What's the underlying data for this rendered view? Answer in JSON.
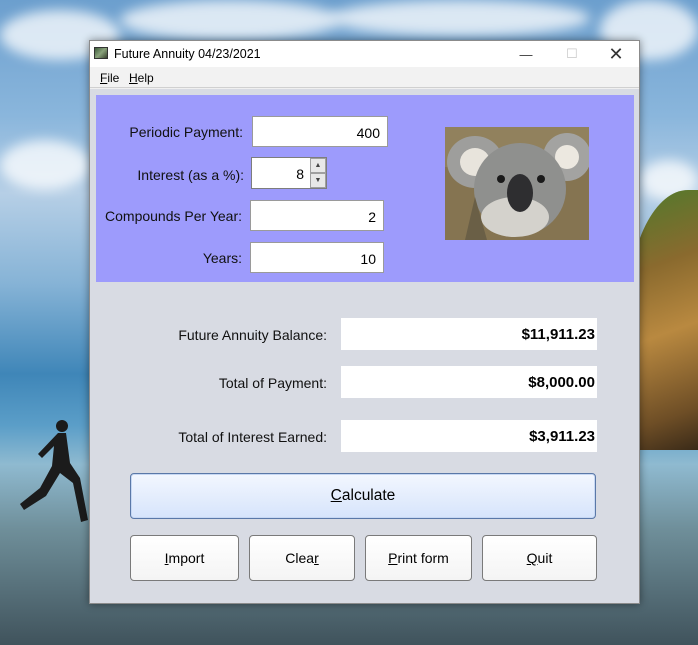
{
  "window": {
    "title": "Future Annuity 04/23/2021",
    "controls": {
      "minimize": "—",
      "maximize": "☐",
      "close": "✕"
    }
  },
  "menu": [
    {
      "mnemonic": "F",
      "rest": "ile"
    },
    {
      "mnemonic": "H",
      "rest": "elp"
    }
  ],
  "inputs": {
    "periodic_payment": {
      "label": "Periodic Payment:",
      "value": "400"
    },
    "interest": {
      "label": "Interest (as a %):",
      "value": "8"
    },
    "compounds": {
      "label": "Compounds Per Year:",
      "value": "2"
    },
    "years": {
      "label": "Years:",
      "value": "10"
    }
  },
  "results": {
    "future_balance": {
      "label": "Future Annuity Balance:",
      "value": "$11,911.23"
    },
    "total_payment": {
      "label": "Total of Payment:",
      "value": "$8,000.00"
    },
    "total_interest": {
      "label": "Total of Interest Earned:",
      "value": "$3,911.23"
    }
  },
  "buttons": {
    "calculate": {
      "pre": "",
      "mnemonic": "C",
      "post": "alculate"
    },
    "import": {
      "pre": "",
      "mnemonic": "I",
      "post": "mport"
    },
    "clear": {
      "pre": "Clea",
      "mnemonic": "r",
      "post": ""
    },
    "print": {
      "pre": "",
      "mnemonic": "P",
      "post": "rint form"
    },
    "quit": {
      "pre": "",
      "mnemonic": "Q",
      "post": "uit"
    }
  },
  "icons": [
    "app-icon",
    "koala-photo",
    "spin-up-icon",
    "spin-down-icon"
  ],
  "colors": {
    "input_panel_bg": "#9d9bfc",
    "content_bg": "#d8dbe3",
    "calculate_bg": "#d6e4fb"
  }
}
